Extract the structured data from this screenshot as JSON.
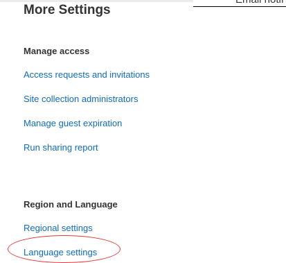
{
  "header": {
    "cutoff_text": "Email notif"
  },
  "panel": {
    "title": "More Settings"
  },
  "manage_access": {
    "heading": "Manage access",
    "links": [
      "Access requests and invitations",
      "Site collection administrators",
      "Manage guest expiration",
      "Run sharing report"
    ]
  },
  "region_language": {
    "heading": "Region and Language",
    "links": [
      "Regional settings",
      "Language settings"
    ]
  },
  "colors": {
    "link": "#0f6cbd",
    "heading": "#333333",
    "annotation": "#e53935"
  }
}
